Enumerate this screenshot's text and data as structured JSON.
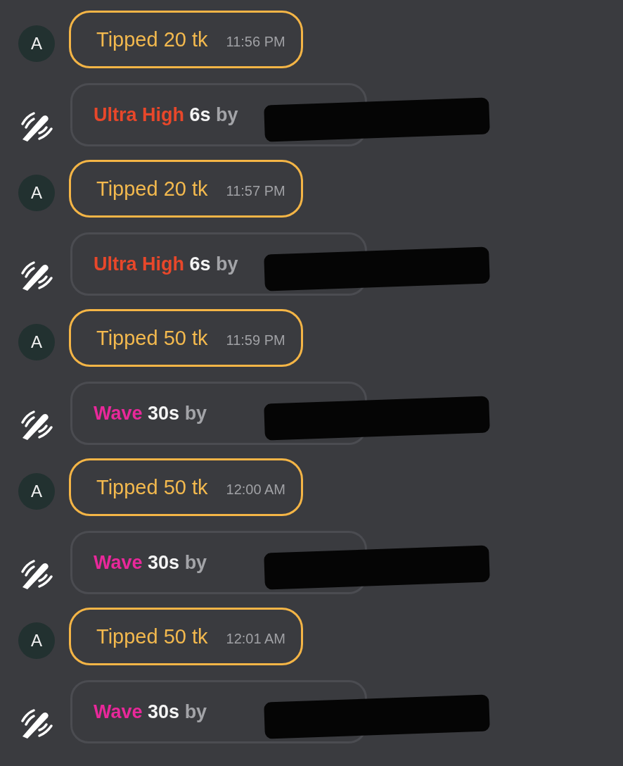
{
  "messages": [
    {
      "kind": "tip",
      "avatar": "A",
      "text": "Tipped 20 tk",
      "time": "11:56 PM"
    },
    {
      "kind": "vibe",
      "level": "Ultra High",
      "color": "#e8472a",
      "duration": "6s",
      "by": "by"
    },
    {
      "kind": "tip",
      "avatar": "A",
      "text": "Tipped 20 tk",
      "time": "11:57 PM"
    },
    {
      "kind": "vibe",
      "level": "Ultra High",
      "color": "#e8472a",
      "duration": "6s",
      "by": "by"
    },
    {
      "kind": "tip",
      "avatar": "A",
      "text": "Tipped 50 tk",
      "time": "11:59 PM"
    },
    {
      "kind": "vibe",
      "level": "Wave",
      "color": "#e8289a",
      "duration": "30s",
      "by": "by"
    },
    {
      "kind": "tip",
      "avatar": "A",
      "text": "Tipped 50 tk",
      "time": "12:00 AM"
    },
    {
      "kind": "vibe",
      "level": "Wave",
      "color": "#e8289a",
      "duration": "30s",
      "by": "by"
    },
    {
      "kind": "tip",
      "avatar": "A",
      "text": "Tipped 50 tk",
      "time": "12:01 AM"
    },
    {
      "kind": "vibe",
      "level": "Wave",
      "color": "#e8289a",
      "duration": "30s",
      "by": "by"
    }
  ]
}
